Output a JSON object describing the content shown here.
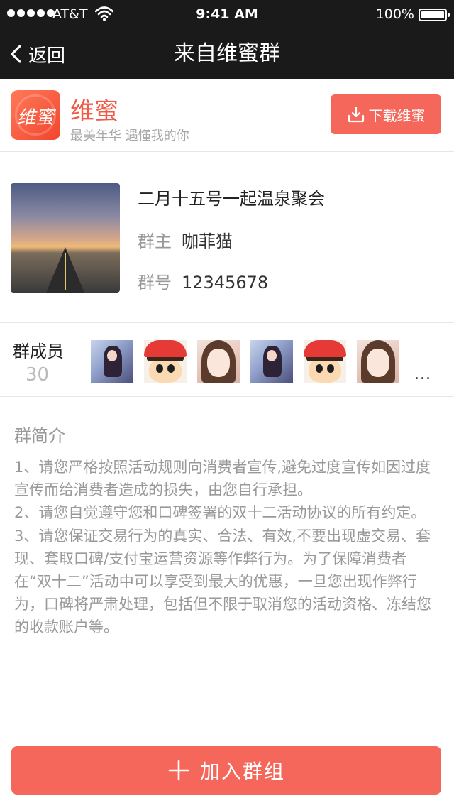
{
  "status_bar": {
    "carrier": "AT&T",
    "time": "9:41 AM",
    "battery": "100%"
  },
  "nav": {
    "back_label": "返回",
    "title": "来自维蜜群"
  },
  "app_banner": {
    "logo_text": "维蜜",
    "name": "维蜜",
    "slogan": "最美年华 遇懂我的你",
    "download_label": "下载维蜜"
  },
  "group": {
    "name": "二月十五号一起温泉聚会",
    "owner_label": "群主",
    "owner": "咖菲猫",
    "number_label": "群号",
    "number": "12345678"
  },
  "members": {
    "title": "群成员",
    "count": "30",
    "avatars": [
      "girl-avatar",
      "cartoon-avatar",
      "girl-avatar",
      "girl-avatar",
      "cartoon-avatar",
      "girl-avatar"
    ],
    "more": "..."
  },
  "intro": {
    "title": "群简介",
    "paragraphs": [
      "1、请您严格按照活动规则向消费者宣传,避免过度宣传如因过度宣传而给消费者造成的损失，由您自行承担。",
      "2、请您自觉遵守您和口碑签署的双十二活动协议的所有约定。",
      "3、请您保证交易行为的真实、合法、有效,不要出现虚交易、套现、套取口碑/支付宝运营资源等作弊行为。为了保障消费者在“双十二”活动中可以享受到最大的优惠，一旦您出现作弊行为，口碑将严肃处理，包括但不限于取消您的活动资格、冻结您的收款账户等。"
    ]
  },
  "join_button": {
    "label": "加入群组"
  },
  "colors": {
    "nav_bg": "#1a1a1a",
    "accent": "#f5675a",
    "brand_text": "#f35a45",
    "muted_text": "#999999"
  }
}
